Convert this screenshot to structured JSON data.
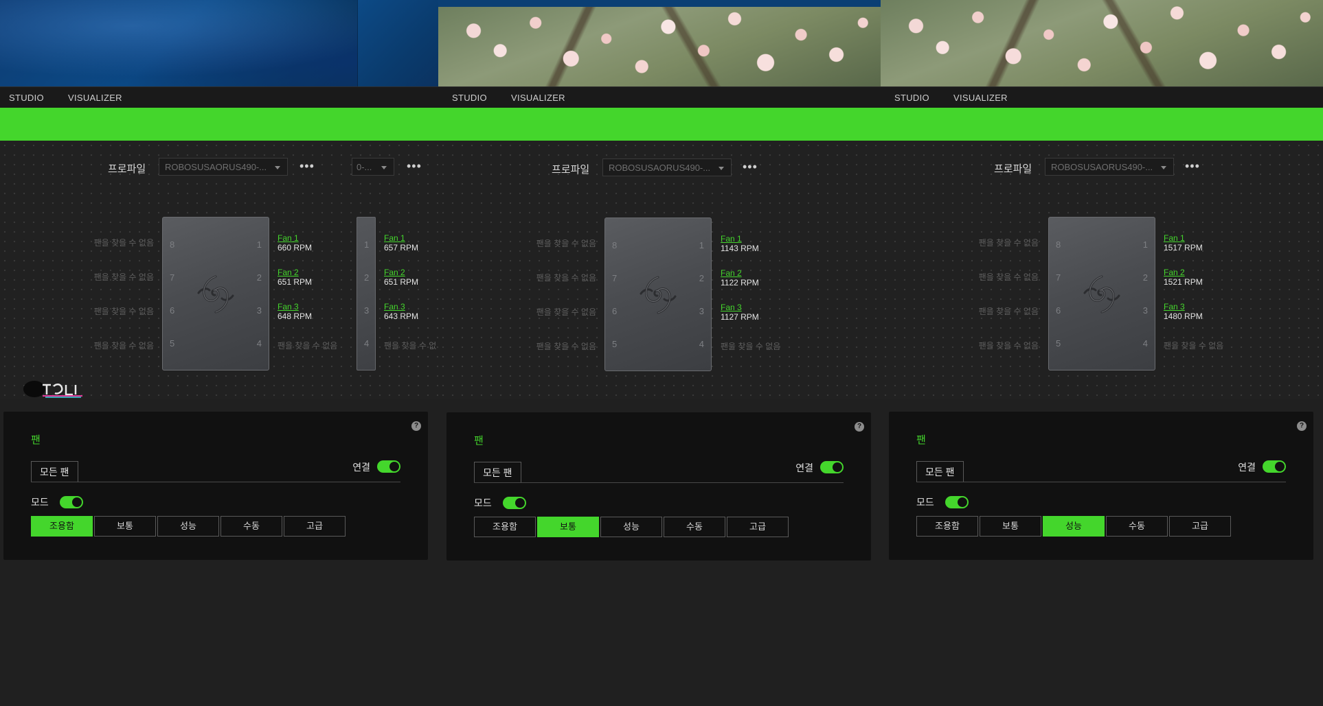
{
  "colors": {
    "accent": "#44d62c",
    "card_bg": "#111111",
    "page_bg": "#1f1f1f"
  },
  "tabs": {
    "studio": "STUDIO",
    "visualizer": "VISUALIZER"
  },
  "profile": {
    "label": "프로파일",
    "value": "ROBOSUSAORUS490-...",
    "value_partial": "0-..."
  },
  "fan_not_found": "팬을 찾을 수 없음",
  "fan_not_found_cut": "팬을 찾을 수 없",
  "device_ports": {
    "left": [
      "8",
      "7",
      "6",
      "5"
    ],
    "right": [
      "1",
      "2",
      "3",
      "4"
    ]
  },
  "fan_labels": [
    "Fan 1",
    "Fan 2",
    "Fan 3"
  ],
  "panels": [
    {
      "fan1_rpm": "660 RPM",
      "fan2_rpm": "651 RPM",
      "fan3_rpm": "648 RPM",
      "active_mode": 0
    },
    {
      "fan1_rpm": "1143 RPM",
      "fan2_rpm": "1122 RPM",
      "fan3_rpm": "1127 RPM",
      "active_mode": 1
    },
    {
      "fan1_rpm": "1517 RPM",
      "fan2_rpm": "1521 RPM",
      "fan3_rpm": "1480 RPM",
      "active_mode": 2
    }
  ],
  "partial_panel": {
    "fan1_rpm": "657 RPM",
    "fan2_rpm": "651 RPM",
    "fan3_rpm": "643 RPM"
  },
  "card": {
    "title": "팬",
    "help": "?",
    "all_fans_tab": "모든 팬",
    "connection_label": "연결",
    "mode_label": "모드",
    "modes": [
      "조용함",
      "보통",
      "성능",
      "수동",
      "고급"
    ]
  },
  "icons": {
    "more": "more-horizontal-icon",
    "caret": "chevron-down-icon",
    "logo": "razer-snake-logo-icon"
  }
}
